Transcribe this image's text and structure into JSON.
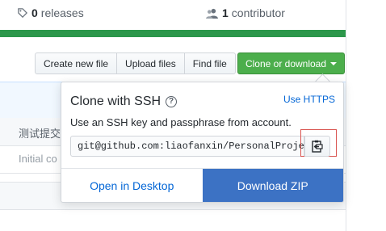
{
  "stats": {
    "releases_count": "0",
    "releases_label": "releases",
    "contributors_count": "1",
    "contributors_label": "contributor"
  },
  "toolbar": {
    "create_new_file": "Create new file",
    "upload_files": "Upload files",
    "find_file": "Find file",
    "clone_or_download": "Clone or download"
  },
  "files": {
    "commit_message": "测试提交",
    "initial_commit": "Initial co"
  },
  "popup": {
    "title": "Clone with SSH",
    "use_https": "Use HTTPS",
    "description": "Use an SSH key and passphrase from account.",
    "clone_url": "git@github.com:liaofanxin/PersonalProject",
    "open_in_desktop": "Open in Desktop",
    "download_zip": "Download ZIP"
  },
  "colors": {
    "clone_button": "#4cae4c",
    "download_zip": "#3c72c4",
    "progress_bar": "#2c974b",
    "link": "#0366d6"
  },
  "icons": [
    "tag-icon",
    "people-icon",
    "caret-down-icon",
    "question-icon",
    "clipboard-icon"
  ]
}
